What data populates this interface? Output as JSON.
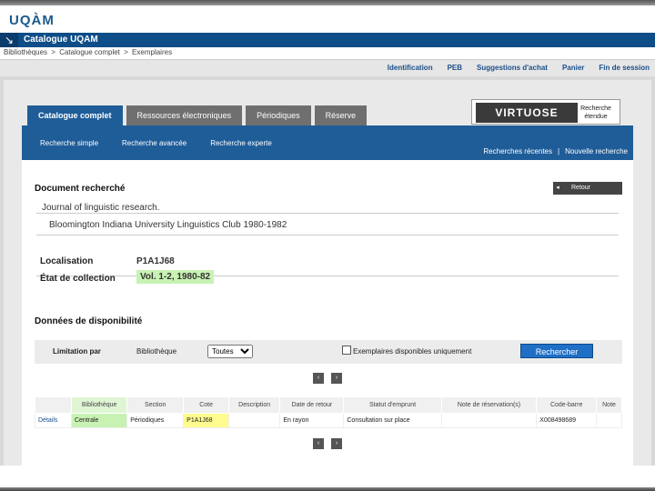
{
  "brand": {
    "logo_text": "UQÀM"
  },
  "titlebar": {
    "title": "Catalogue UQAM"
  },
  "breadcrumb": [
    "Bibliothèques",
    ">",
    "Catalogue complet",
    ">",
    "Exemplaires"
  ],
  "toplinks": [
    "Identification",
    "PEB",
    "Suggestions d'achat",
    "Panier",
    "Fin de session"
  ],
  "tabs": [
    {
      "label": "Catalogue complet",
      "active": true
    },
    {
      "label": "Ressources électroniques",
      "active": false
    },
    {
      "label": "Périodiques",
      "active": false
    },
    {
      "label": "Réserve",
      "active": false
    }
  ],
  "virtuose": {
    "logo": "VIRTUOSE",
    "link": "Recherche étendue"
  },
  "subnav": {
    "left": [
      "Recherche simple",
      "Recherche avancée",
      "Recherche experte"
    ],
    "right": [
      "Recherches récentes",
      "|",
      "Nouvelle recherche"
    ]
  },
  "document": {
    "heading": "Document recherché",
    "back_button": "Retour",
    "title_line": "Journal of linguistic research.",
    "pub_line": "Bloomington Indiana University Linguistics Club 1980-1982",
    "location_label": "Localisation",
    "location_value": "P1A1J68",
    "holdings_label": "État de collection",
    "holdings_value": "Vol. 1-2, 1980-82"
  },
  "availability": {
    "heading": "Données de disponibilité",
    "filter_label": "Limitation par",
    "filter_field": "Bibliothèque",
    "filter_selected": "Toutes",
    "checkbox_label": "Exemplaires disponibles uniquement",
    "search_button": "Rechercher",
    "pager": [
      "‹",
      "›"
    ]
  },
  "table": {
    "columns": [
      "",
      "Bibliothèque",
      "Section",
      "Cote",
      "Description",
      "Date de retour",
      "Statut d'emprunt",
      "Note de réservation(s)",
      "Code-barre",
      "Note"
    ],
    "rows": [
      [
        "Détails",
        "Centrale",
        "Périodiques",
        "P1A1J68",
        "",
        "En rayon",
        "Consultation sur place",
        "",
        "X008498689",
        ""
      ]
    ]
  },
  "colors": {
    "primary_blue": "#1f5d99",
    "title_blue": "#0e4d87",
    "highlight_green": "#c8f2b3",
    "highlight_yellow": "#fffb8f"
  }
}
